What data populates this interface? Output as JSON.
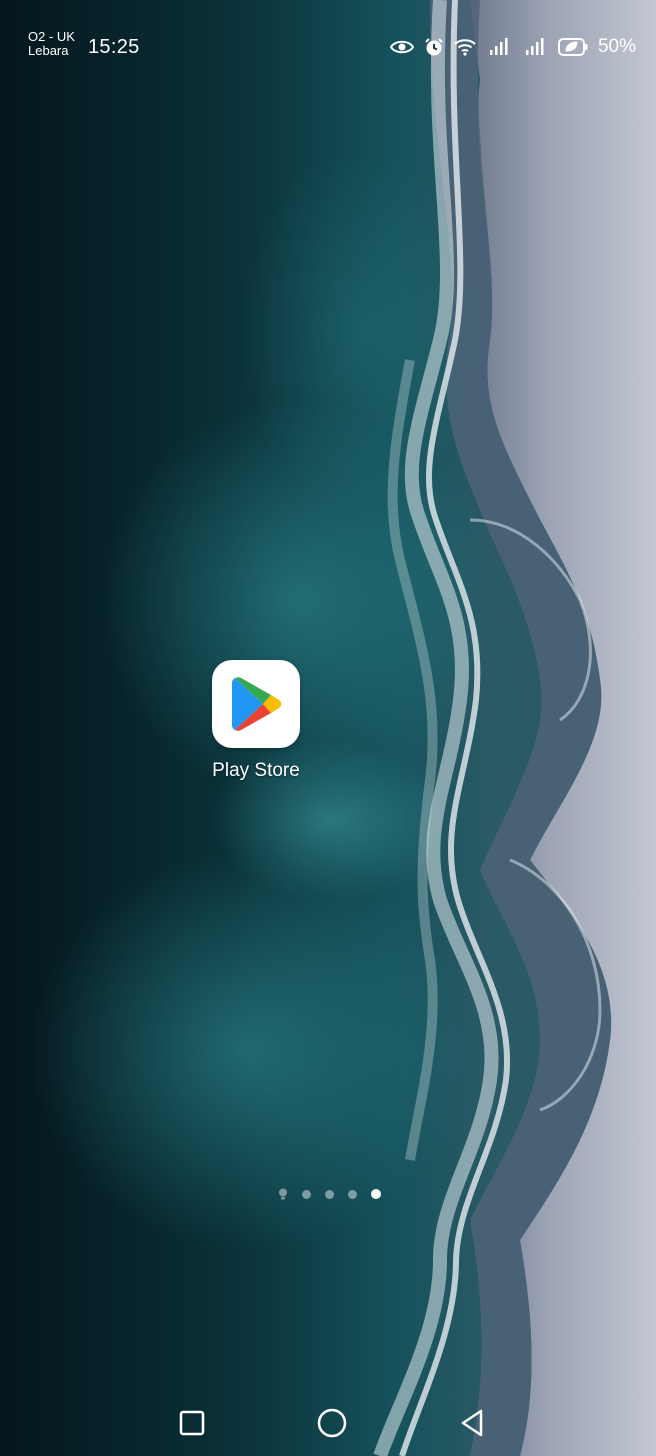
{
  "status_bar": {
    "carrier_line1": "O2 - UK",
    "carrier_line2": "Lebara",
    "time": "15:25",
    "battery_percent": "50%",
    "icons": [
      "eye-icon",
      "alarm-icon",
      "wifi-icon",
      "signal-icon",
      "signal-icon",
      "battery-saver-icon"
    ]
  },
  "home": {
    "apps": [
      {
        "label": "Play Store",
        "icon": "play-store-icon"
      }
    ],
    "page_indicator": {
      "pages": 4,
      "active_page": 4,
      "leading_icon": "bulb-icon"
    }
  },
  "nav_bar": {
    "buttons": [
      "recents-square-icon",
      "home-circle-icon",
      "back-triangle-icon"
    ]
  },
  "colors": {
    "ocean_dark": "#06242c",
    "ocean_teal": "#1b5f68",
    "foam": "#dfe6ea",
    "sand": "#a6adbe",
    "text": "#ffffff"
  }
}
